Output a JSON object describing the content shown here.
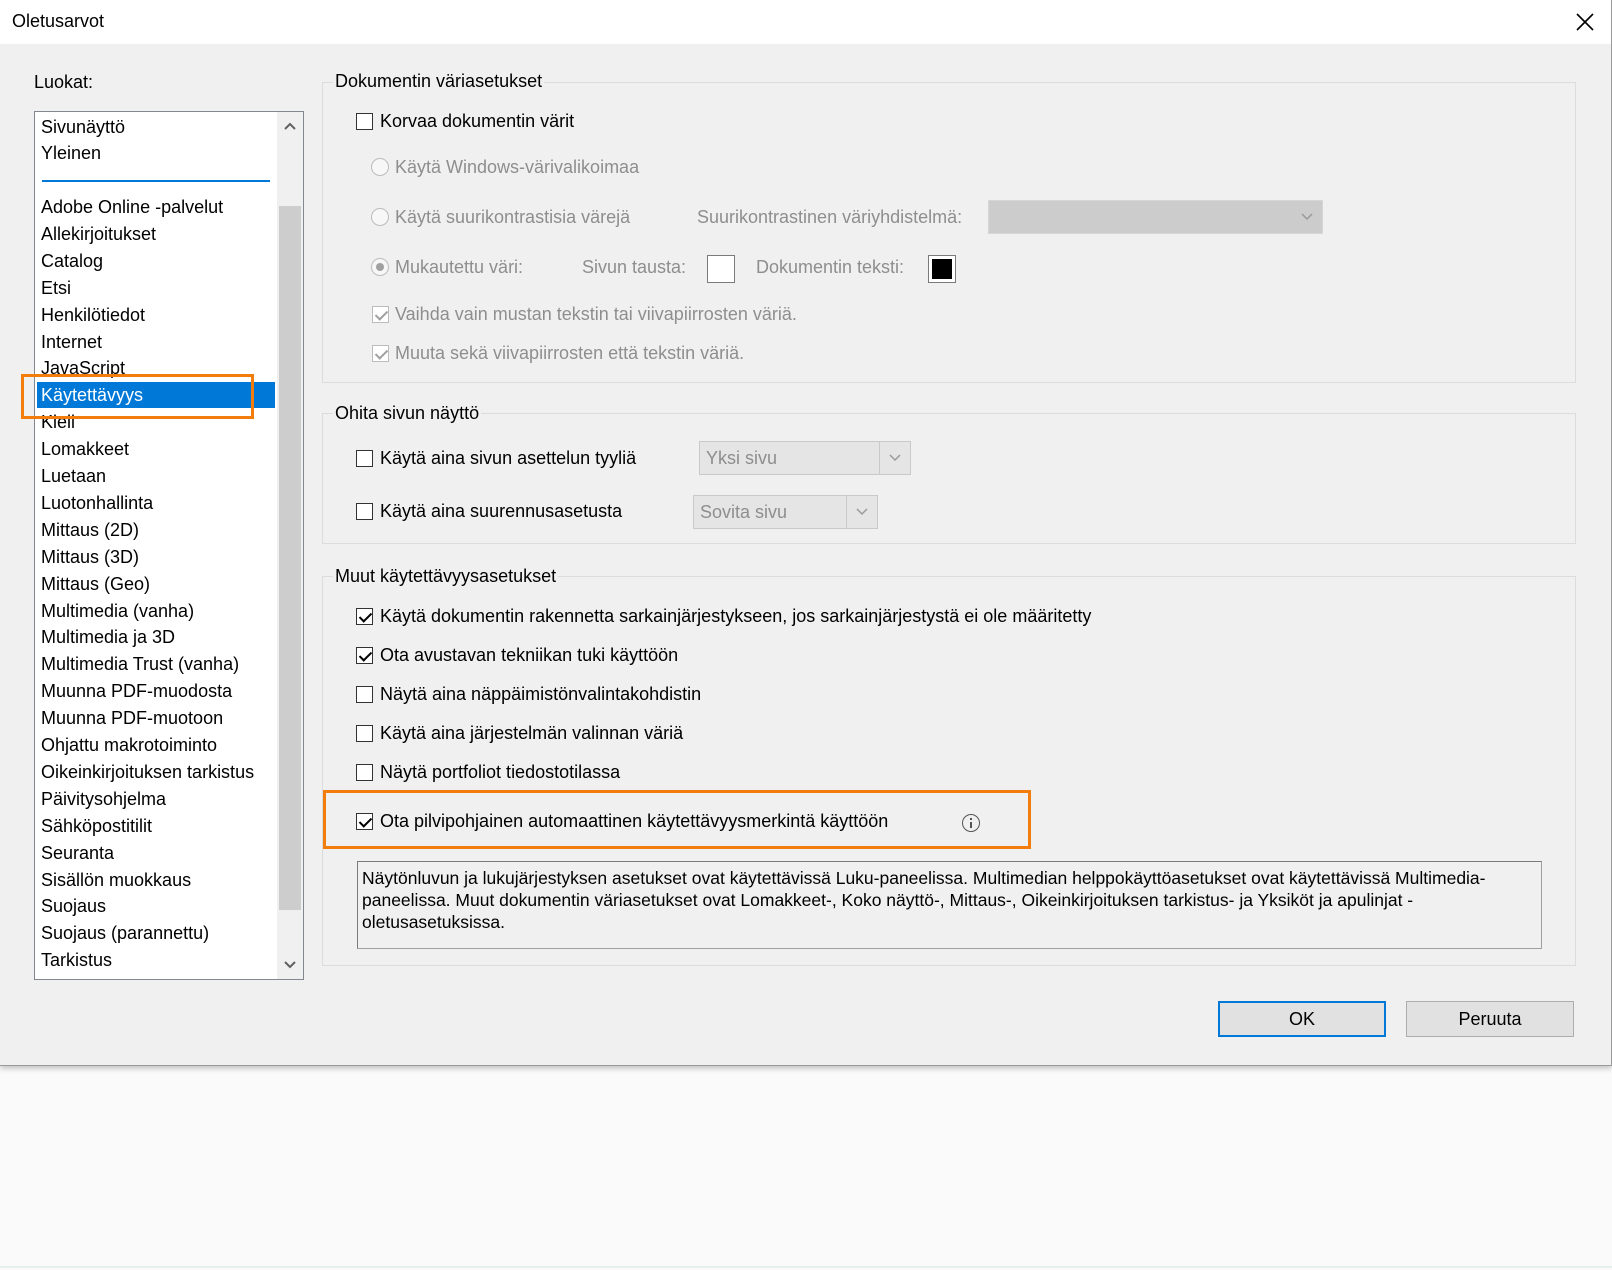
{
  "window": {
    "title": "Oletusarvot"
  },
  "categories": {
    "label": "Luokat:",
    "top_items": [
      "Sivunäyttö",
      "Yleinen"
    ],
    "items": [
      "Adobe Online -palvelut",
      "Allekirjoitukset",
      "Catalog",
      "Etsi",
      "Henkilötiedot",
      "Internet",
      "JavaScript",
      "Käytettävyys",
      "Kieli",
      "Lomakkeet",
      "Luetaan",
      "Luotonhallinta",
      "Mittaus (2D)",
      "Mittaus (3D)",
      "Mittaus (Geo)",
      "Multimedia (vanha)",
      "Multimedia ja 3D",
      "Multimedia Trust (vanha)",
      "Muunna PDF-muodosta",
      "Muunna PDF-muotoon",
      "Ohjattu makrotoiminto",
      "Oikeinkirjoituksen tarkistus",
      "Päivitysohjelma",
      "Sähköpostitilit",
      "Seuranta",
      "Sisällön muokkaus",
      "Suojaus",
      "Suojaus (parannettu)",
      "Tarkistus"
    ],
    "selected": "Käytettävyys"
  },
  "color_group": {
    "title": "Dokumentin väriasetukset",
    "replace_colors": {
      "label": "Korvaa dokumentin värit",
      "checked": false
    },
    "windows_palette": {
      "label": "Käytä Windows-värivalikoimaa",
      "selected": false
    },
    "high_contrast": {
      "label": "Käytä suurikontrastisia värejä",
      "selected": false
    },
    "high_contrast_scheme_label": "Suurikontrastinen väriyhdistelmä:",
    "high_contrast_scheme_value": "",
    "custom_color": {
      "label": "Mukautettu väri:",
      "selected": true
    },
    "page_background_label": "Sivun tausta:",
    "page_background_color": "#ffffff",
    "document_text_label": "Dokumentin teksti:",
    "document_text_color": "#000000",
    "only_black": {
      "label": "Vaihda vain mustan tekstin tai viivapiirrosten väriä.",
      "checked": true
    },
    "line_and_text": {
      "label": "Muuta sekä viivapiirrosten että tekstin väriä.",
      "checked": true
    }
  },
  "page_display_group": {
    "title": "Ohita sivun näyttö",
    "layout": {
      "label": "Käytä aina sivun asettelun tyyliä",
      "checked": false,
      "value": "Yksi sivu"
    },
    "zoom": {
      "label": "Käytä aina suurennusasetusta",
      "checked": false,
      "value": "Sovita sivu"
    }
  },
  "other_group": {
    "title": "Muut käytettävyysasetukset",
    "options": [
      {
        "label": "Käytä dokumentin rakennetta sarkainjärjestykseen, jos sarkainjärjestystä ei ole määritetty",
        "checked": true
      },
      {
        "label": "Ota avustavan tekniikan tuki käyttöön",
        "checked": true
      },
      {
        "label": "Näytä aina näppäimistönvalintakohdistin",
        "checked": false
      },
      {
        "label": "Käytä aina järjestelmän valinnan väriä",
        "checked": false
      },
      {
        "label": "Näytä portfoliot tiedostotilassa",
        "checked": false
      },
      {
        "label": "Ota pilvipohjainen automaattinen käytettävyysmerkintä käyttöön",
        "checked": true
      }
    ],
    "info_text": "Näytönluvun ja lukujärjestyksen asetukset ovat käytettävissä Luku-paneelissa. Multimedian helppokäyttöasetukset ovat käytettävissä Multimedia-paneelissa. Muut dokumentin väriasetukset ovat Lomakkeet-, Koko näyttö-, Mittaus-, Oikeinkirjoituksen tarkistus- ja Yksiköt ja apulinjat -oletusasetuksissa."
  },
  "buttons": {
    "ok": "OK",
    "cancel": "Peruuta"
  },
  "colors": {
    "accent": "#0078d7",
    "highlight": "#f27d0c"
  }
}
